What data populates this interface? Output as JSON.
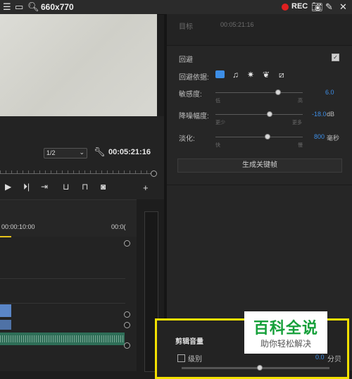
{
  "capture_bar": {
    "title": "660x770",
    "rec_label": "REC"
  },
  "preview": {
    "resolution": "1/2",
    "timecode": "00:05:21:16"
  },
  "timeline": {
    "timecode_start": "00:00:10:00",
    "timecode_end": "00:0("
  },
  "right_panel": {
    "target_label": "目标",
    "target_timecode": "00:05:21:16",
    "ducking": {
      "title": "回避",
      "enabled": true,
      "based_on_label": "回避依据:",
      "sensitivity": {
        "label": "敏感度:",
        "low": "低",
        "high": "高",
        "value": "6.0",
        "level": 0.72
      },
      "reduce": {
        "label": "降噪幅度:",
        "less": "更少",
        "more": "更多",
        "value": "-18.0",
        "unit": "dB",
        "level": 0.62
      },
      "fade": {
        "label": "淡化:",
        "fast": "快",
        "slow": "慢",
        "value": "800",
        "unit": "毫秒",
        "level": 0.6
      },
      "generate_button": "生成关键帧"
    },
    "clip_volume": {
      "title": "剪辑音量",
      "level_label": "级别",
      "level_value": "0.0",
      "level_unit": "分贝"
    }
  },
  "watermark": {
    "line1": "百科全说",
    "line2": "助你轻松解决"
  }
}
